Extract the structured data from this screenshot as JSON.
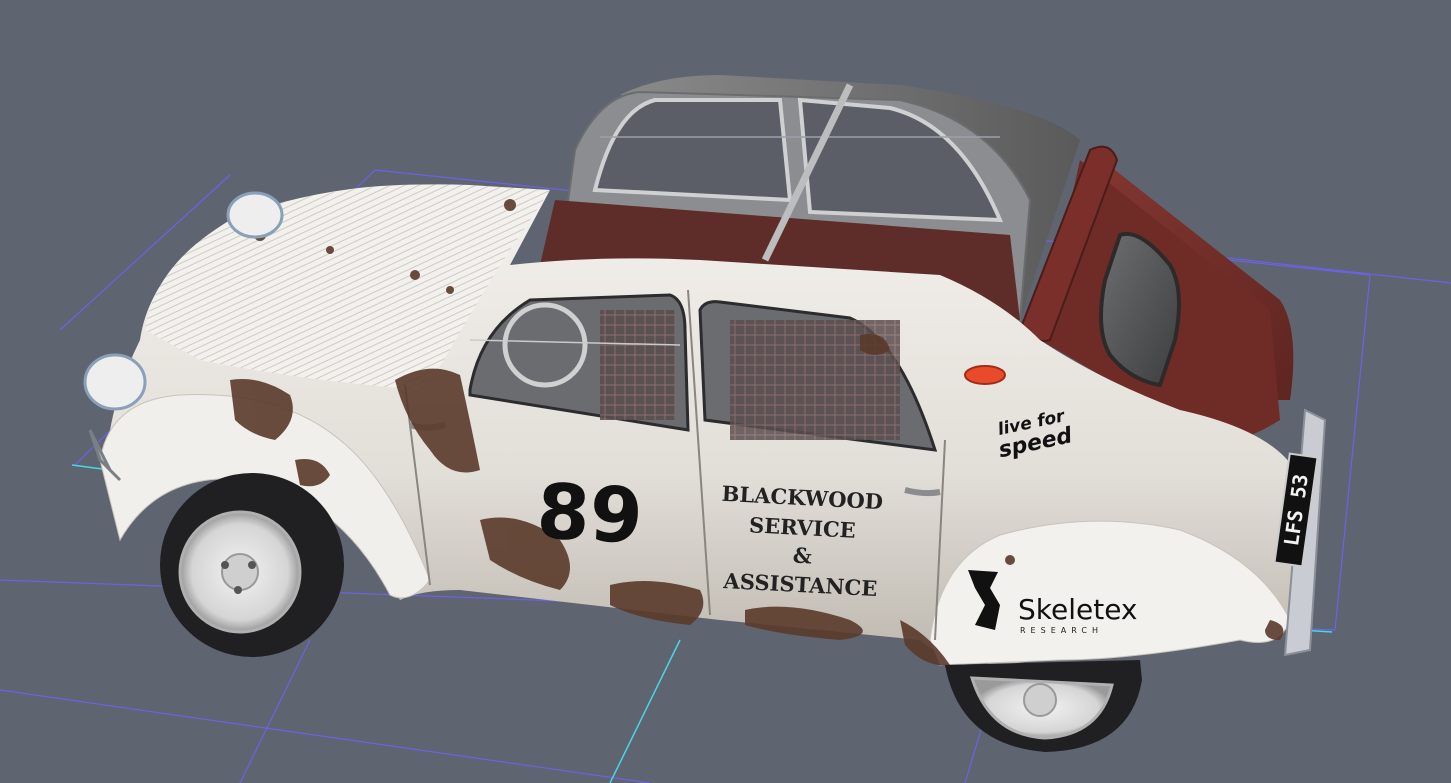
{
  "viewport": {
    "background": "#5f6471",
    "grid_color": "#6a63e6",
    "axis_color": "#45d8e6"
  },
  "vehicle": {
    "race_number": "89",
    "door_text": {
      "line1": "BLACKWOOD",
      "line2": "SERVICE",
      "line3": "&",
      "line4": "ASSISTANCE"
    },
    "sponsor_lfs": {
      "line1": "live for",
      "line2": "speed"
    },
    "sponsor_skeletex": {
      "name": "Skeletex",
      "tagline": "RESEARCH"
    },
    "license_plate": "LFS 53",
    "body_color": "#e9e6e1",
    "roof_color": "#7a2f2a",
    "rust_color": "#5a3a2a"
  }
}
